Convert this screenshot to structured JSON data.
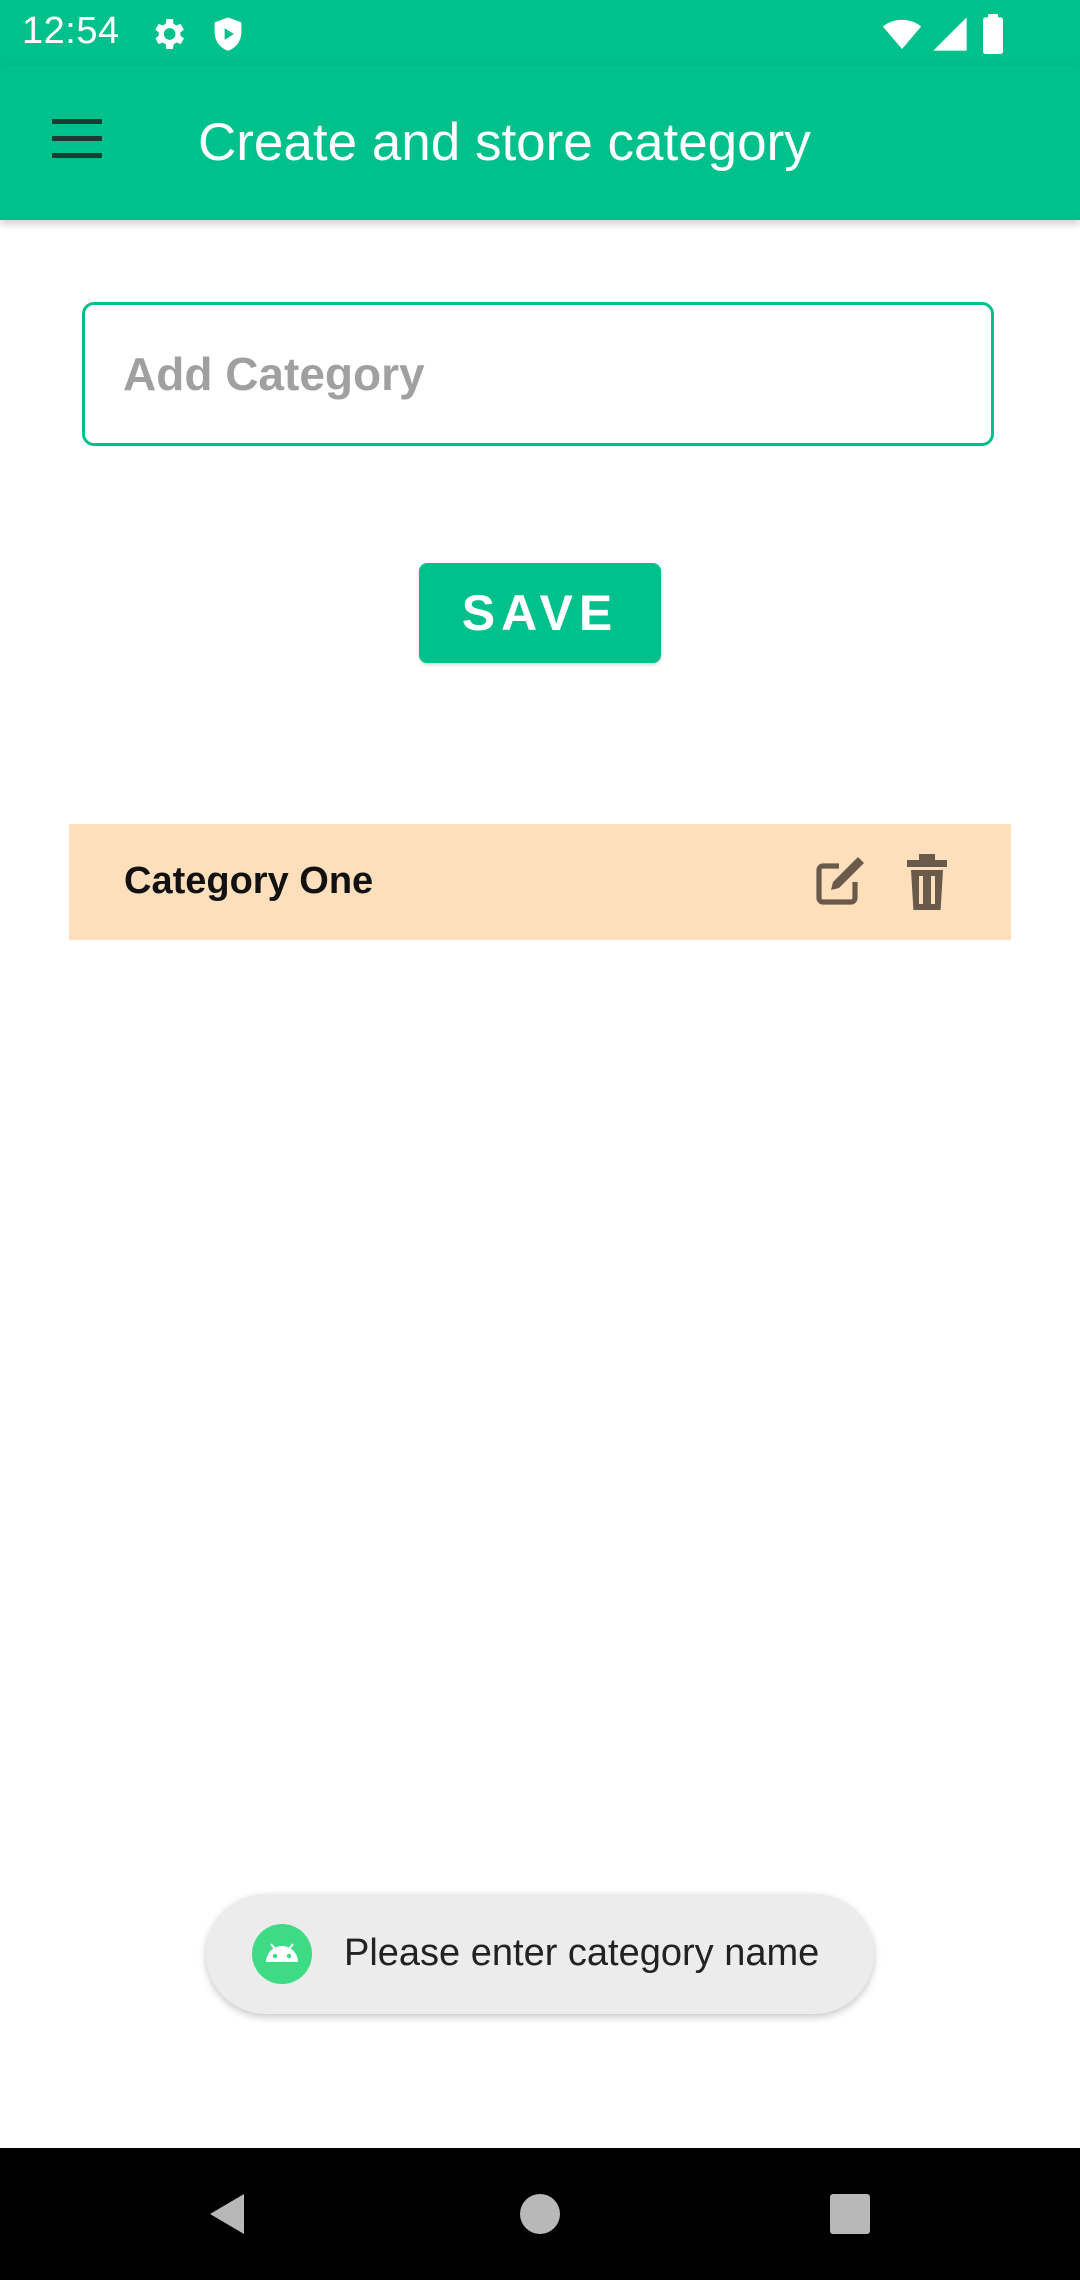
{
  "status_bar": {
    "time": "12:54",
    "left_icons": [
      "gear-icon",
      "shield-icon"
    ],
    "right_icons": [
      "wifi-icon",
      "cell-signal-icon",
      "battery-icon"
    ]
  },
  "app_bar": {
    "menu_icon": "hamburger-menu-icon",
    "title": "Create and store category"
  },
  "form": {
    "category_input": {
      "value": "",
      "placeholder": "Add Category"
    },
    "save_label": "SAVE"
  },
  "categories": [
    {
      "name": "Category One",
      "actions": [
        "edit-icon",
        "delete-icon"
      ]
    }
  ],
  "toast": {
    "icon": "android-icon",
    "message": "Please enter category name"
  },
  "nav_bar": [
    "back-icon",
    "home-icon",
    "recents-icon"
  ],
  "colors": {
    "primary": "#00c08b",
    "list_item_background": "#fde0bb",
    "toast_background": "#ececec"
  }
}
